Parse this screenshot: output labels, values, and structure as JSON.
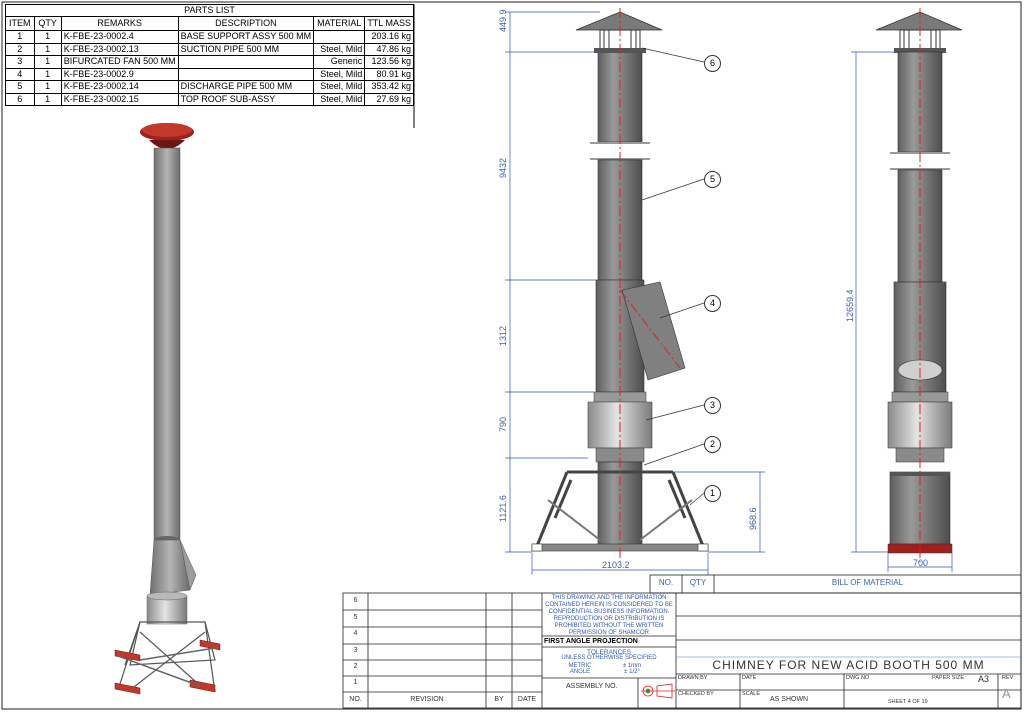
{
  "parts_list": {
    "title": "PARTS LIST",
    "headers": [
      "ITEM",
      "QTY",
      "REMARKS",
      "DESCRIPTION",
      "MATERIAL",
      "TTL MASS"
    ],
    "rows": [
      {
        "item": "1",
        "qty": "1",
        "remarks": "K-FBE-23-0002.4",
        "description": "BASE SUPPORT ASSY 500 MM",
        "material": "",
        "mass": "203.16 kg"
      },
      {
        "item": "2",
        "qty": "1",
        "remarks": "K-FBE-23-0002.13",
        "description": "SUCTION PIPE 500 MM",
        "material": "Steel, Mild",
        "mass": "47.86 kg"
      },
      {
        "item": "3",
        "qty": "1",
        "remarks": "BIFURCATED FAN 500 MM",
        "description": "",
        "material": "Generic",
        "mass": "123.56 kg"
      },
      {
        "item": "4",
        "qty": "1",
        "remarks": "K-FBE-23-0002.9",
        "description": "",
        "material": "Steel, Mild",
        "mass": "80.91 kg"
      },
      {
        "item": "5",
        "qty": "1",
        "remarks": "K-FBE-23-0002.14",
        "description": "DISCHARGE PIPE 500 MM",
        "material": "Steel, Mild",
        "mass": "353.42 kg"
      },
      {
        "item": "6",
        "qty": "1",
        "remarks": "K-FBE-23-0002.15",
        "description": "TOP ROOF SUB-ASSY",
        "material": "Steel, Mild",
        "mass": "27.69 kg"
      }
    ]
  },
  "dimensions": {
    "top_cap": "449.9",
    "discharge": "9432",
    "bifurcated": "1312",
    "fan": "790",
    "base": "1121.6",
    "base_inner": "968.6",
    "base_width": "2103.2",
    "total_height": "12659.4",
    "side_width": "700"
  },
  "balloons": [
    "6",
    "5",
    "4",
    "3",
    "2",
    "1"
  ],
  "bom_header": {
    "no": "NO.",
    "qty": "QTY",
    "title": "BILL OF MATERIAL"
  },
  "revision_block": {
    "rows": [
      "6",
      "5",
      "4",
      "3",
      "2",
      "1"
    ],
    "col_no": "NO.",
    "col_revision": "REVISION",
    "col_by": "BY",
    "col_date": "DATE"
  },
  "confidential_note": "THIS DRAWING AND THE INFORMATION CONTAINED HEREIN IS CONSIDERED TO BE CONFIDENTIAL BUSINESS INFORMATION. REPRODUCTION OR DISTRIBUTION IS PROHIBITED WITHOUT THE WRITTEN PERMISSION OF SHAMCOR",
  "projection": "FIRST ANGLE PROJECTION",
  "tolerances": {
    "title": "TOLERANCES",
    "subtitle": "UNLESS OTHERWISE SPECIFIED",
    "metric_label": "METRIC",
    "metric_value": "± 1mm",
    "angle_label": "ANGLE",
    "angle_value": "± 1/2°"
  },
  "assembly_no_label": "ASSEMBLY NO.",
  "drawing_title": "CHIMNEY FOR NEW ACID BOOTH 500 MM",
  "title_block": {
    "drawn_by": "DRAWN BY",
    "date": "DATE",
    "checked_by": "CHECKED BY",
    "scale_label": "SCALE",
    "scale_value": "AS SHOWN",
    "dwg_no": "DWG NO",
    "paper_size_label": "PAPER SIZE",
    "paper_size": "A3",
    "rev_label": "REV",
    "rev_value": "A",
    "sheet": "SHEET 4 OF 19"
  },
  "colors": {
    "dimension": "#2d57b5",
    "centerline": "#e02020",
    "steel": "#8a8a8a",
    "roof": "#a02020"
  }
}
